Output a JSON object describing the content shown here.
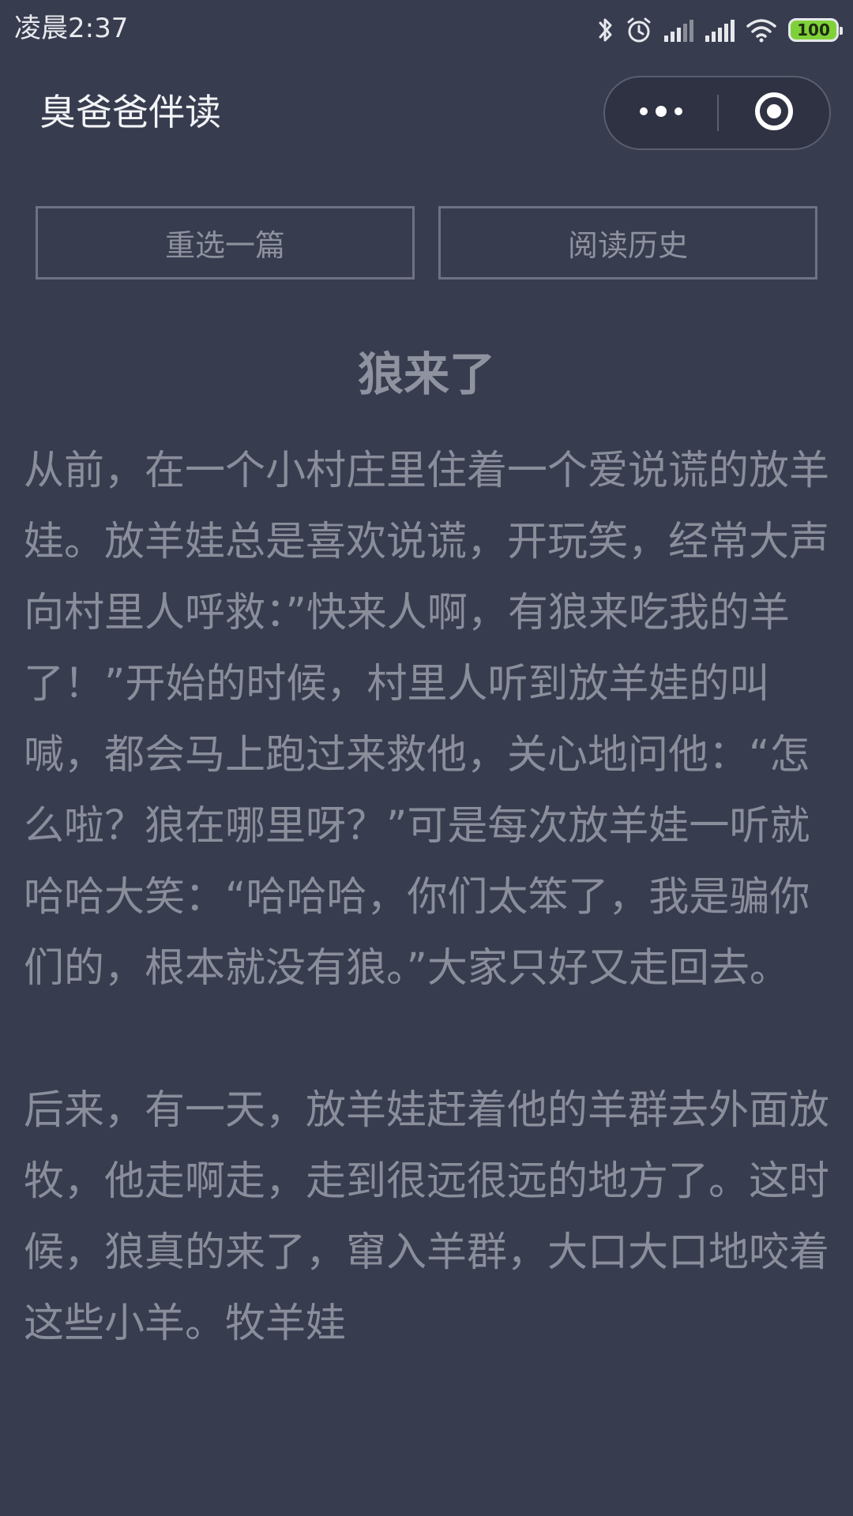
{
  "status_bar": {
    "time": "凌晨2:37",
    "battery": "100",
    "icons": [
      "bluetooth-icon",
      "alarm-icon",
      "signal-icon",
      "signal-icon",
      "wifi-icon",
      "battery-icon"
    ]
  },
  "nav": {
    "title": "臭爸爸伴读",
    "more_icon": "more-dots-icon",
    "close_icon": "target-close-icon"
  },
  "actions": {
    "reselect_label": "重选一篇",
    "history_label": "阅读历史"
  },
  "story": {
    "title": "狼来了",
    "paragraphs": [
      "从前，在一个小村庄里住着一个爱说谎的放羊娃。放羊娃总是喜欢说谎，开玩笑，经常大声向村里人呼救：”快来人啊，有狼来吃我的羊了！”开始的时候，村里人听到放羊娃的叫喊，都会马上跑过来救他，关心地问他：“怎么啦？狼在哪里呀？”可是每次放羊娃一听就哈哈大笑：“哈哈哈，你们太笨了，我是骗你们的，根本就没有狼。”大家只好又走回去。",
      "后来，有一天，放羊娃赶着他的羊群去外面放牧，他走啊走，走到很远很远的地方了。这时候，狼真的来了，窜入羊群，大口大口地咬着这些小羊。牧羊娃"
    ]
  },
  "colors": {
    "background": "#383c4f",
    "text": "#8a8e9b",
    "title_bar_text": "#f3f4f7",
    "battery": "#7fd13a"
  }
}
